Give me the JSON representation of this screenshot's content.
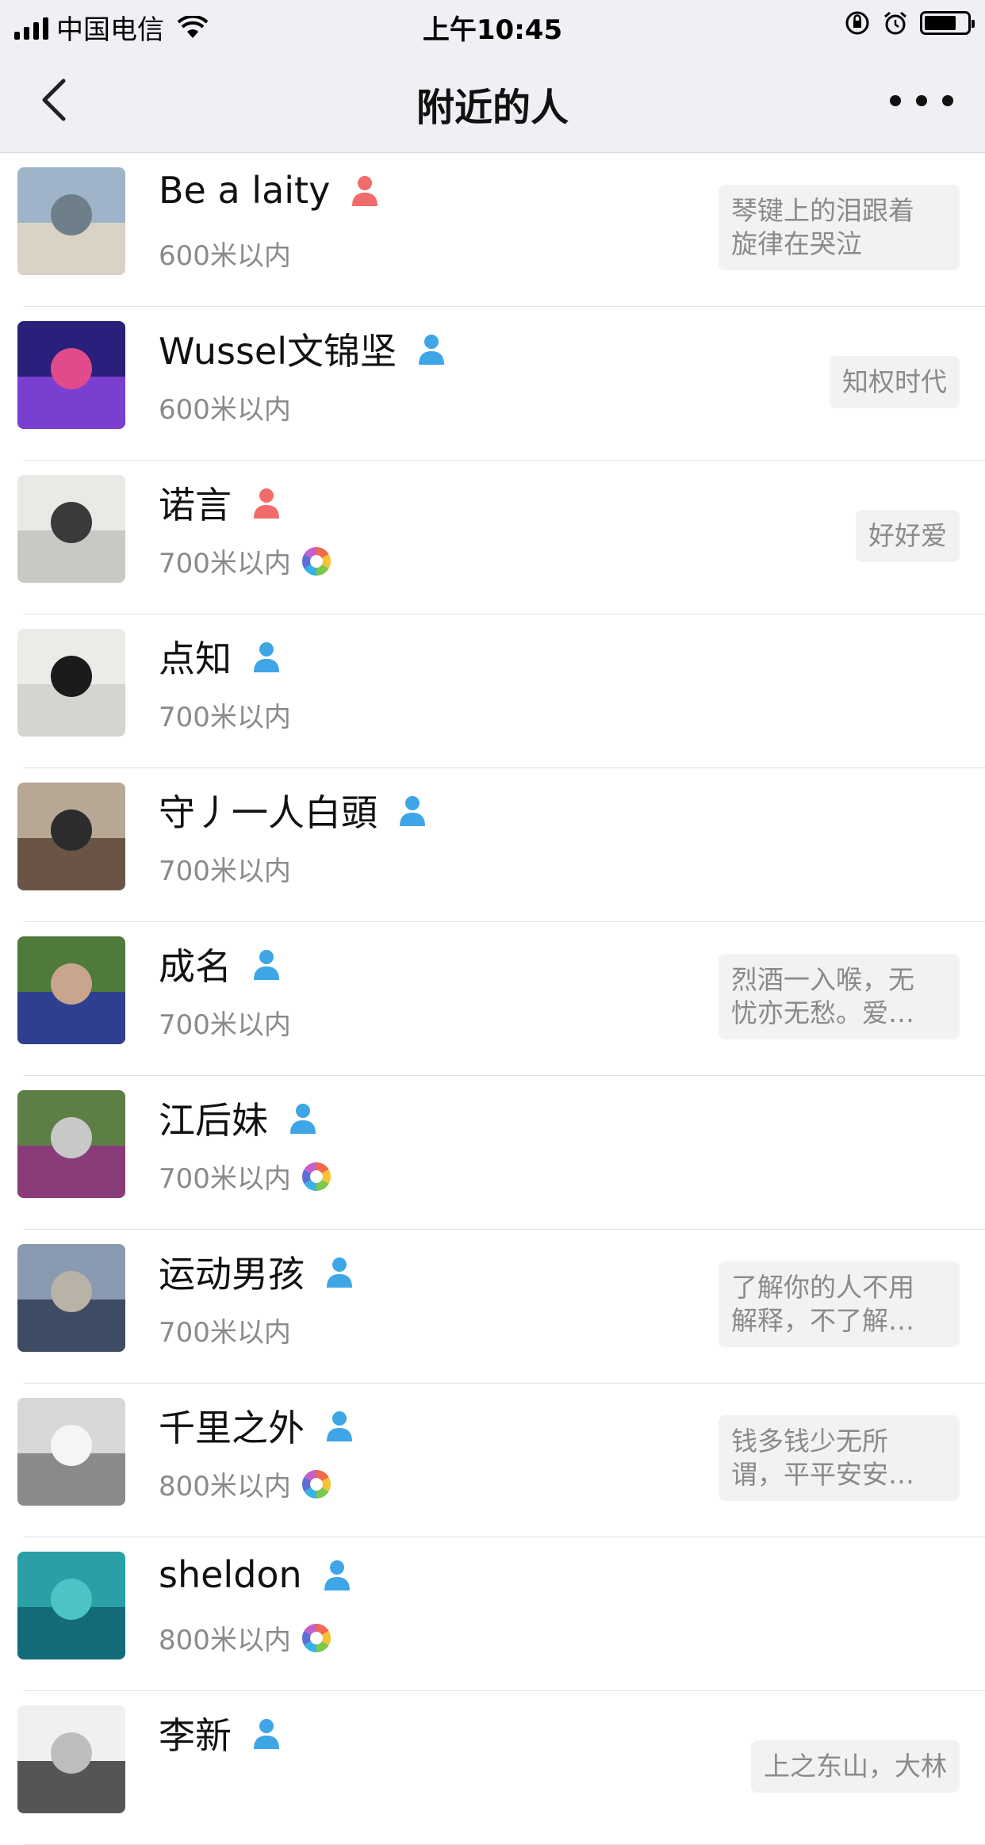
{
  "status_bar": {
    "carrier": "中国电信",
    "time": "上午10:45",
    "battery_level": 0.75
  },
  "nav": {
    "title": "附近的人"
  },
  "people": [
    {
      "name": "Be a laity",
      "gender": "female",
      "distance": "600米以内",
      "moments": false,
      "signature": [
        "琴键上的泪跟着",
        "旋律在哭泣"
      ],
      "avatar_colors": [
        "#9fb4c8",
        "#d9d2c5",
        "#6f7f8a"
      ]
    },
    {
      "name": "Wussel文锦坚",
      "gender": "male",
      "distance": "600米以内",
      "moments": false,
      "signature": [
        "知权时代"
      ],
      "avatar_colors": [
        "#2a1f7a",
        "#7b3fd0",
        "#e24b8b"
      ]
    },
    {
      "name": "诺言",
      "gender": "female",
      "distance": "700米以内",
      "moments": true,
      "signature": [
        "好好爱"
      ],
      "avatar_colors": [
        "#e9e9e6",
        "#c9c9c4",
        "#3a3a3a"
      ]
    },
    {
      "name": "点知",
      "gender": "male",
      "distance": "700米以内",
      "moments": false,
      "signature": [],
      "avatar_colors": [
        "#ecebe7",
        "#d6d4cf",
        "#1b1b1b"
      ]
    },
    {
      "name": "守丿一人白頭",
      "gender": "male",
      "distance": "700米以内",
      "moments": false,
      "signature": [],
      "avatar_colors": [
        "#b7a795",
        "#6a5446",
        "#2c2c2c"
      ]
    },
    {
      "name": "成名",
      "gender": "male",
      "distance": "700米以内",
      "moments": false,
      "signature": [
        "烈酒一入喉，无",
        "忧亦无愁。爱…"
      ],
      "avatar_colors": [
        "#4f7a3a",
        "#2f3f8f",
        "#c8a58c"
      ]
    },
    {
      "name": "江后妹",
      "gender": "male",
      "distance": "700米以内",
      "moments": true,
      "signature": [],
      "avatar_colors": [
        "#5d7f46",
        "#8a3b7a",
        "#c7c9c8"
      ]
    },
    {
      "name": "运动男孩",
      "gender": "male",
      "distance": "700米以内",
      "moments": false,
      "signature": [
        "了解你的人不用",
        "解释，不了解…"
      ],
      "avatar_colors": [
        "#8a9ab0",
        "#3e4c63",
        "#b9b2a6"
      ]
    },
    {
      "name": "千里之外",
      "gender": "male",
      "distance": "800米以内",
      "moments": true,
      "signature": [
        "钱多钱少无所",
        "谓，平平安安…"
      ],
      "avatar_colors": [
        "#d8d8d8",
        "#8a8a8a",
        "#f5f5f5"
      ]
    },
    {
      "name": "sheldon",
      "gender": "male",
      "distance": "800米以内",
      "moments": true,
      "signature": [],
      "avatar_colors": [
        "#2a9fa6",
        "#136b7a",
        "#4cc3c6"
      ]
    },
    {
      "name": "李新",
      "gender": "male",
      "distance": "",
      "moments": false,
      "signature": [
        "上之东山，大林"
      ],
      "avatar_colors": [
        "#f0f0f0",
        "#555555",
        "#bdbdbd"
      ]
    }
  ]
}
